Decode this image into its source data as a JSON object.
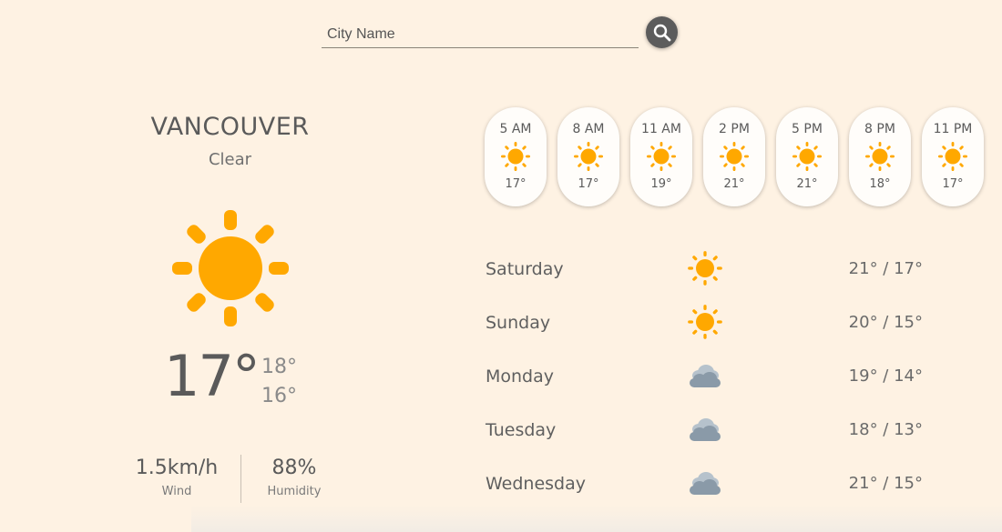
{
  "search": {
    "placeholder": "City Name",
    "value": ""
  },
  "current": {
    "city": "VANCOUVER",
    "condition": "Clear",
    "icon": "sun-icon",
    "temp": "17°",
    "high": "18°",
    "low": "16°",
    "wind": {
      "value": "1.5km/h",
      "label": "Wind"
    },
    "humidity": {
      "value": "88%",
      "label": "Humidity"
    }
  },
  "hourly": [
    {
      "time": "5 AM",
      "icon": "sun-icon",
      "temp": "17°"
    },
    {
      "time": "8 AM",
      "icon": "sun-icon",
      "temp": "17°"
    },
    {
      "time": "11 AM",
      "icon": "sun-icon",
      "temp": "19°"
    },
    {
      "time": "2 PM",
      "icon": "sun-icon",
      "temp": "21°"
    },
    {
      "time": "5 PM",
      "icon": "sun-icon",
      "temp": "21°"
    },
    {
      "time": "8 PM",
      "icon": "sun-icon",
      "temp": "18°"
    },
    {
      "time": "11 PM",
      "icon": "sun-icon",
      "temp": "17°"
    }
  ],
  "daily": [
    {
      "day": "Saturday",
      "icon": "sun-icon",
      "temps": "21° / 17°"
    },
    {
      "day": "Sunday",
      "icon": "sun-icon",
      "temps": "20° / 15°"
    },
    {
      "day": "Monday",
      "icon": "cloud-icon",
      "temps": "19° / 14°"
    },
    {
      "day": "Tuesday",
      "icon": "cloud-icon",
      "temps": "18° / 13°"
    },
    {
      "day": "Wednesday",
      "icon": "cloud-icon",
      "temps": "21° / 15°"
    }
  ],
  "colors": {
    "background": "#fef2e3",
    "sun": "#ffa800",
    "cloud_front": "#8a9aa8",
    "cloud_back": "#b6c2cc",
    "search_button": "#5c5c5c"
  }
}
